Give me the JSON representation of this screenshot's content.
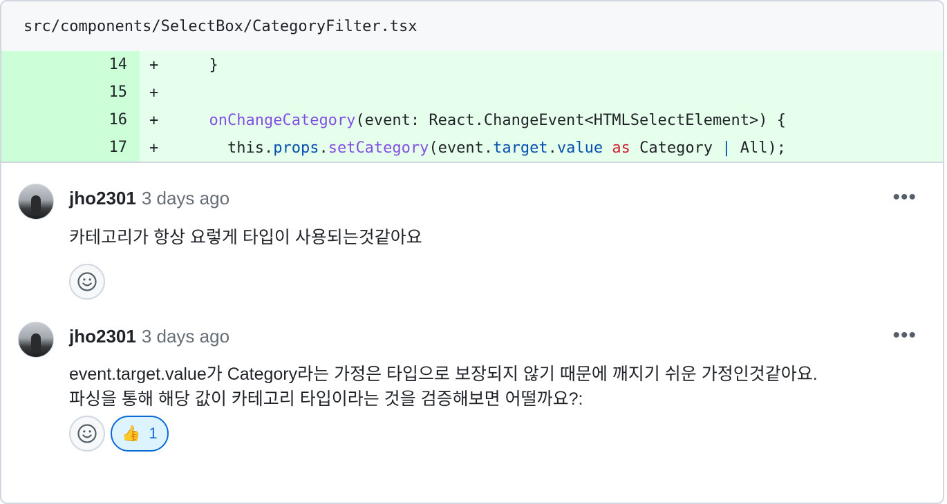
{
  "file": {
    "path": "src/components/SelectBox/CategoryFilter.tsx"
  },
  "diff": {
    "lines": [
      {
        "num": "14",
        "marker": "+",
        "text": "  }"
      },
      {
        "num": "15",
        "marker": "+",
        "text": ""
      },
      {
        "num": "16",
        "marker": "+",
        "text": "  onChangeCategory(event: React.ChangeEvent<HTMLSelectElement>) {"
      },
      {
        "num": "17",
        "marker": "+",
        "text": "    this.props.setCategory(event.target.value as Category | All);"
      }
    ],
    "tokens": {
      "l1_code": "  }",
      "l3_indent": "  ",
      "l3_func": "onChangeCategory",
      "l3_rest": "(event: React.ChangeEvent<HTMLSelectElement>) {",
      "l4_a": "    this.",
      "l4_props": "props",
      "l4_dot1": ".",
      "l4_func": "setCategory",
      "l4_b": "(event.",
      "l4_target": "target",
      "l4_dot2": ".",
      "l4_value": "value",
      "l4_sp1": " ",
      "l4_as": "as",
      "l4_c": " Category ",
      "l4_pipe": "|",
      "l4_d": " All);"
    }
  },
  "comments": [
    {
      "author": "jho2301",
      "time": "3 days ago",
      "menu": "•••",
      "body": [
        "카테고리가 항상 요렇게 타입이 사용되는것같아요"
      ],
      "reactions": []
    },
    {
      "author": "jho2301",
      "time": "3 days ago",
      "menu": "•••",
      "body": [
        "event.target.value가 Category라는 가정은 타입으로 보장되지 않기 때문에 깨지기 쉬운 가정인것같아요.",
        "파싱을 통해 해당 값이 카테고리 타입이라는 것을 검증해보면 어떨까요?:"
      ],
      "reactions": [
        {
          "icon": "👍",
          "count": "1"
        }
      ]
    }
  ],
  "icons": {
    "avatar": "avatar",
    "smiley": "smiley-icon",
    "kebab": "kebab-menu-icon",
    "thumbs_up": "thumbs-up-icon"
  },
  "colors": {
    "added_line_bg": "#e6ffec",
    "added_num_bg": "#ccffd8",
    "function": "#8250df",
    "property": "#0550ae",
    "keyword": "#cf222e",
    "reaction_active": "#0969da"
  }
}
